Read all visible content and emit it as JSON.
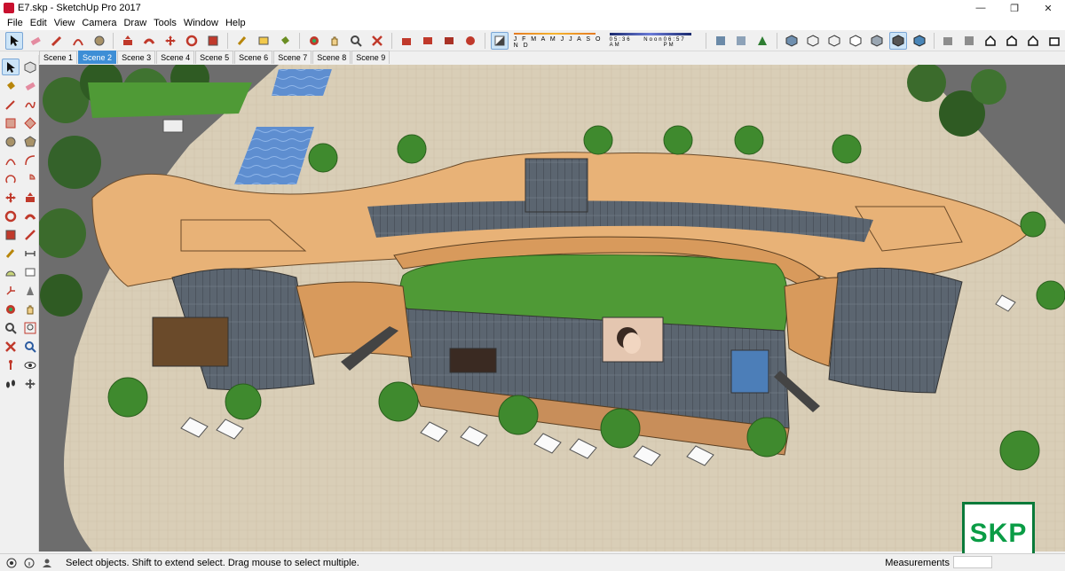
{
  "window": {
    "title": "E7.skp - SketchUp Pro 2017",
    "minimize": "—",
    "maximize": "❐",
    "close": "✕"
  },
  "menu": [
    "File",
    "Edit",
    "View",
    "Camera",
    "Draw",
    "Tools",
    "Window",
    "Help"
  ],
  "toolbar": {
    "shadow_months": "J F M A M J J A S O N D",
    "shadow_time_start": "05:36 AM",
    "shadow_time_mid": "Noon",
    "shadow_time_end": "06:57 PM"
  },
  "scenes": [
    "Scene 1",
    "Scene 2",
    "Scene 3",
    "Scene 4",
    "Scene 5",
    "Scene 6",
    "Scene 7",
    "Scene 8",
    "Scene 9"
  ],
  "active_scene": "Scene 2",
  "status": {
    "hint": "Select objects. Shift to extend select. Drag mouse to select multiple.",
    "measurements_label": "Measurements",
    "measurements_value": ""
  },
  "badge": {
    "text": "SKP"
  },
  "colors": {
    "accent_tab": "#3d8ed6",
    "badge_green": "#0a9c45",
    "roof": "#e8b277",
    "plaza": "#d8cdb6",
    "lawn": "#4f9a36",
    "road": "#6b6b6b"
  }
}
